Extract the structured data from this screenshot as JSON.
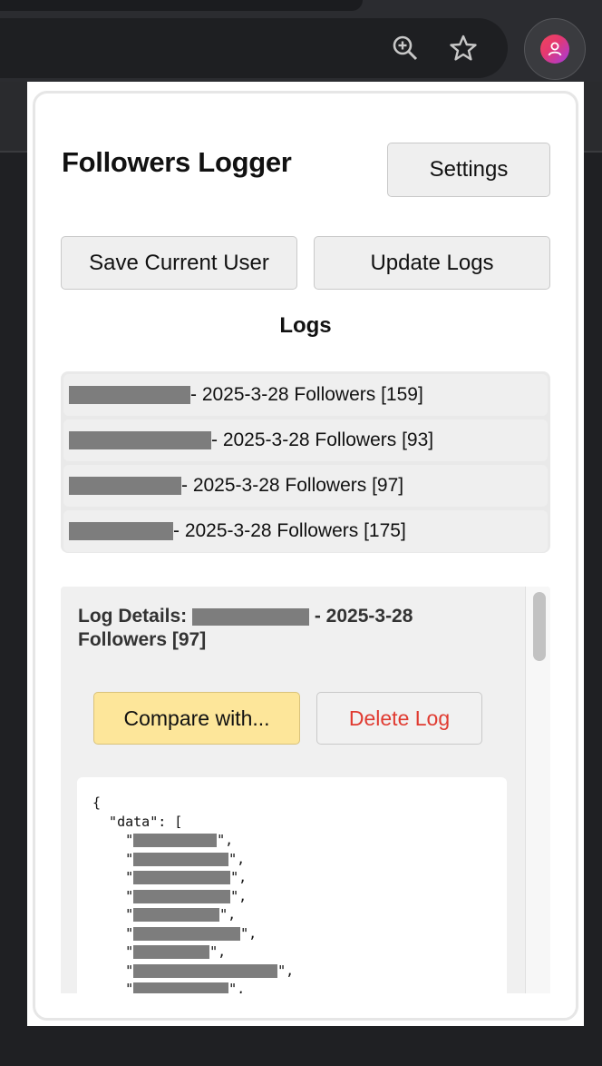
{
  "browser": {
    "zoom_icon": "zoom-in-icon",
    "star_icon": "bookmark-star-icon",
    "profile_icon": "profile-avatar-icon"
  },
  "popup": {
    "title": "Followers Logger",
    "settings_label": "Settings",
    "save_label": "Save Current User",
    "update_label": "Update Logs",
    "logs_heading": "Logs",
    "logs": [
      {
        "suffix": " - 2025-3-28 Followers [159]",
        "redact_w": 134
      },
      {
        "suffix": " - 2025-3-28 Followers [93]",
        "redact_w": 157
      },
      {
        "suffix": " - 2025-3-28 Followers [97]",
        "redact_w": 124
      },
      {
        "suffix": " - 2025-3-28 Followers [175]",
        "redact_w": 115
      }
    ],
    "details": {
      "title_prefix": "Log Details: ",
      "title_suffix": " - 2025-3-28 Followers [97]",
      "compare_label": "Compare with...",
      "delete_label": "Delete Log",
      "json_open": "{",
      "json_data_key": "  \"data\": [",
      "json_items": [
        {
          "w": 92,
          "tail": "\","
        },
        {
          "w": 105,
          "tail": "\","
        },
        {
          "w": 107,
          "tail": "\","
        },
        {
          "w": 107,
          "tail": "\","
        },
        {
          "w": 95,
          "tail": "\","
        },
        {
          "w": 118,
          "tail": "\","
        },
        {
          "w": 84,
          "tail": "\","
        },
        {
          "w": 159,
          "tail": "\","
        },
        {
          "w": 105,
          "tail": "\","
        }
      ]
    }
  },
  "colors": {
    "compare_bg": "#fde69a",
    "delete_text": "#e03b31"
  }
}
